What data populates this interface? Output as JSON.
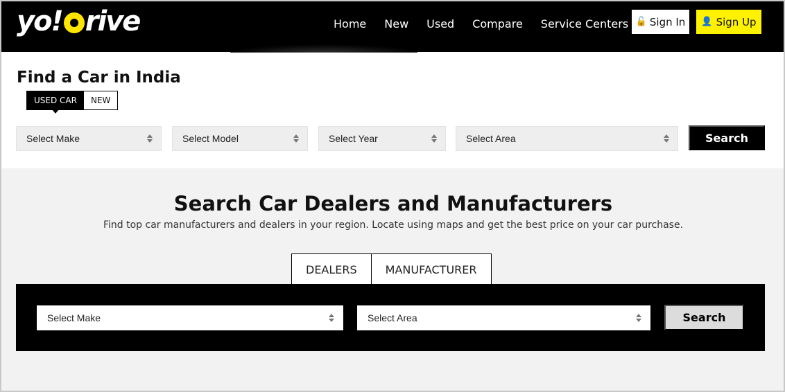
{
  "brand": {
    "logo_left": "yo!",
    "logo_right": "rive"
  },
  "nav": {
    "items": [
      {
        "label": "Home"
      },
      {
        "label": "New"
      },
      {
        "label": "Used"
      },
      {
        "label": "Compare"
      },
      {
        "label": "Service Centers"
      }
    ],
    "sign_in": "Sign In",
    "sign_up": "Sign Up"
  },
  "find_car": {
    "title": "Find a Car in India",
    "toggle": {
      "active": "USED CAR",
      "inactive": "NEW"
    },
    "selects": {
      "make": "Select Make",
      "model": "Select Model",
      "year": "Select Year",
      "area": "Select Area"
    },
    "search_label": "Search"
  },
  "dealers": {
    "title": "Search Car Dealers and Manufacturers",
    "subtitle": "Find top car manufacturers and dealers in your region. Locate using maps and get the best price on your car purchase.",
    "tabs": [
      {
        "label": "DEALERS"
      },
      {
        "label": "MANUFACTURER"
      }
    ],
    "selects": {
      "make": "Select Make",
      "area": "Select Area"
    },
    "search_label": "Search"
  },
  "colors": {
    "header_bg": "#000000",
    "accent_yellow": "#fff200",
    "section_gray": "#f2f2f2"
  },
  "icons": {
    "sign_in": "lock-icon",
    "sign_up": "add-user-icon"
  }
}
